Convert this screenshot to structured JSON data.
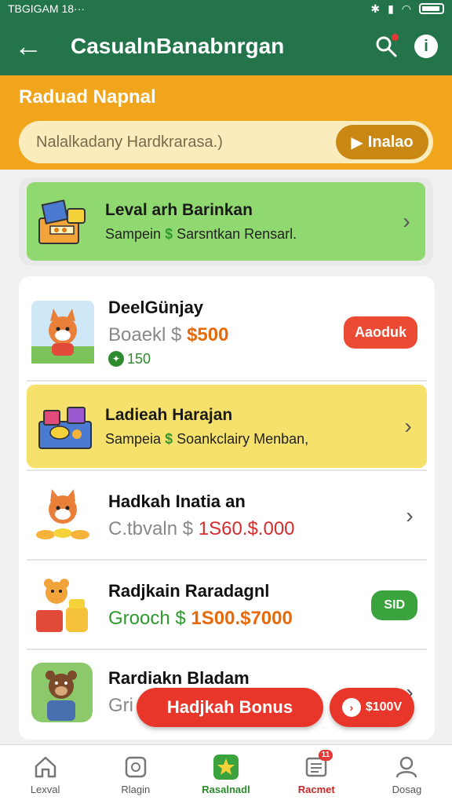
{
  "status_bar": {
    "left_text": "TBGIGAM 18···"
  },
  "app_bar": {
    "back_label": "←",
    "title": "CasualnBanabnrgan",
    "info_label": "i"
  },
  "promo": {
    "title": "Raduad Napnal",
    "input_placeholder": "Nalalkadany Hardkrarasa.)",
    "go_label": "Inalao",
    "go_arrow": "▶"
  },
  "level_card": {
    "title": "Leval arh Barinkan",
    "sub_prefix": "Sampein",
    "sub_dollar": "$",
    "sub_suffix": "Sarsntkan Rensarl.",
    "chevron": "›"
  },
  "list": [
    {
      "title": "DeelGünjay",
      "price_prefix": "Boaekl $",
      "price_value": "$500",
      "coins_icon": "✦",
      "coins": "150",
      "action_label": "Aaoduk"
    },
    {
      "title": "Ladieah Harajan",
      "sub_prefix": "Sampeia",
      "sub_dollar": "$",
      "sub_suffix": "Soankclairy Menban,",
      "chevron": "›"
    },
    {
      "title": "Hadkah Inatia an",
      "price_prefix": "C.tbvaln $",
      "price_value": "1S60.$.000",
      "chevron": "›"
    },
    {
      "title": "Radjkain Raradagnl",
      "price_prefix": "Grooch $",
      "price_value": "1S00.$7000",
      "action_label": "SID"
    },
    {
      "title": "Rardiakn Bladam",
      "price_prefix": "Gri",
      "chevron": "›"
    }
  ],
  "floating": {
    "bonus_label": "Hadjkah Bonus",
    "next_arrow": "›",
    "next_label": "$100V"
  },
  "bottom_nav": [
    {
      "label": "Lexval",
      "icon": "home-icon"
    },
    {
      "label": "Rlagin",
      "icon": "square-icon"
    },
    {
      "label": "Rasalnadl",
      "icon": "star-icon"
    },
    {
      "label": "Racmet",
      "icon": "list-icon",
      "badge": "11"
    },
    {
      "label": "Dosag",
      "icon": "user-icon"
    }
  ],
  "colors": {
    "primary_green": "#23744a",
    "promo_orange": "#f1a51d",
    "accent_red": "#e8362a"
  }
}
